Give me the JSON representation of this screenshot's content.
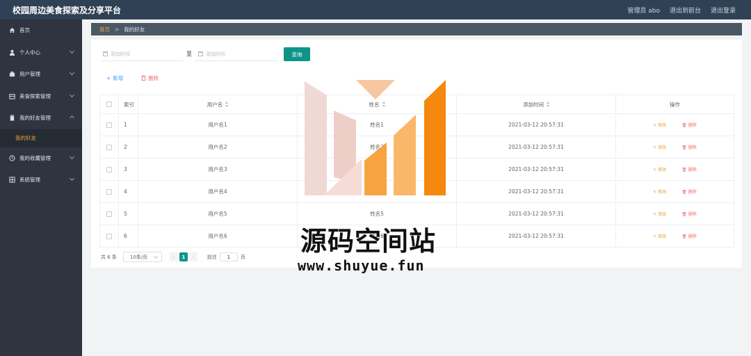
{
  "header": {
    "title": "校园周边美食探索及分享平台",
    "links": [
      "管理员 abo",
      "退出到前台",
      "退出登录"
    ]
  },
  "sidebar": {
    "items": [
      {
        "label": "首页",
        "icon": "home-icon",
        "has_arrow": false
      },
      {
        "label": "个人中心",
        "icon": "user-icon",
        "has_arrow": true
      },
      {
        "label": "用户管理",
        "icon": "building-icon",
        "has_arrow": true
      },
      {
        "label": "美食探索管理",
        "icon": "grid-icon",
        "has_arrow": true
      },
      {
        "label": "我的好友管理",
        "icon": "clipboard-icon",
        "has_arrow": true,
        "expanded": true
      }
    ],
    "active_sub": "我的好友",
    "items_after": [
      {
        "label": "我的收藏管理",
        "icon": "clock-icon",
        "has_arrow": true
      },
      {
        "label": "系统管理",
        "icon": "table-icon",
        "has_arrow": true
      }
    ]
  },
  "breadcrumb": {
    "home": "首页",
    "separator": ">",
    "current": "我的好友"
  },
  "search": {
    "start_placeholder": "添加时间",
    "separator": "至",
    "end_placeholder": "添加时间",
    "query_label": "查询"
  },
  "actions": {
    "add_label": "新增",
    "delete_label": "删除"
  },
  "table": {
    "columns": {
      "index": "索引",
      "username": "用户名",
      "name": "姓名",
      "time": "添加时间",
      "ops": "操作"
    },
    "edit_label": "修改",
    "delete_label": "删除",
    "rows": [
      {
        "index": "1",
        "username": "用户名1",
        "name": "姓名1",
        "time": "2021-03-12 20:57:31"
      },
      {
        "index": "2",
        "username": "用户名2",
        "name": "姓名2",
        "time": "2021-03-12 20:57:31"
      },
      {
        "index": "3",
        "username": "用户名3",
        "name": "姓名3",
        "time": "2021-03-12 20:57:31"
      },
      {
        "index": "4",
        "username": "用户名4",
        "name": "姓名4",
        "time": "2021-03-12 20:57:31"
      },
      {
        "index": "5",
        "username": "用户名5",
        "name": "姓名5",
        "time": "2021-03-12 20:57:31"
      },
      {
        "index": "6",
        "username": "用户名6",
        "name": "姓名6",
        "time": "2021-03-12 20:57:31"
      }
    ]
  },
  "pagination": {
    "total": "共 6 条",
    "page_size": "10条/页",
    "current_page": "1",
    "goto_label": "前往",
    "goto_value": "1",
    "page_unit": "页"
  },
  "watermark": {
    "title": "源码空间站",
    "url": "www.shuyue.fun"
  },
  "colors": {
    "accent": "#0f9488",
    "header_bg": "#304156",
    "sidebar_bg": "#2e3540",
    "active": "#e6a23c",
    "danger": "#f56c6c",
    "link": "#409eff"
  }
}
